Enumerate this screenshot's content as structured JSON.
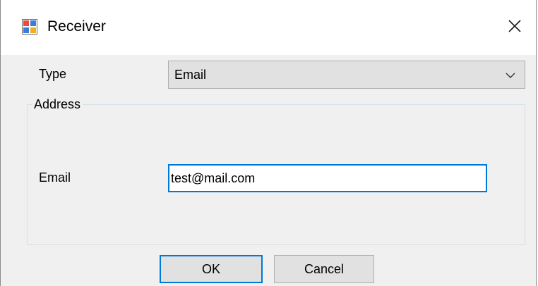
{
  "window": {
    "title": "Receiver",
    "app_icon": "form-app-icon",
    "close_icon": "close-icon"
  },
  "form": {
    "type_label": "Type",
    "type_value": "Email",
    "type_dropdown_icon": "chevron-down-icon",
    "group_title": "Address",
    "email_label": "Email",
    "email_value": "test@mail.com"
  },
  "buttons": {
    "ok_label": "OK",
    "cancel_label": "Cancel"
  },
  "colors": {
    "focus_accent": "#0078d7",
    "dialog_background": "#f0f0f0",
    "button_face": "#e1e1e1"
  }
}
